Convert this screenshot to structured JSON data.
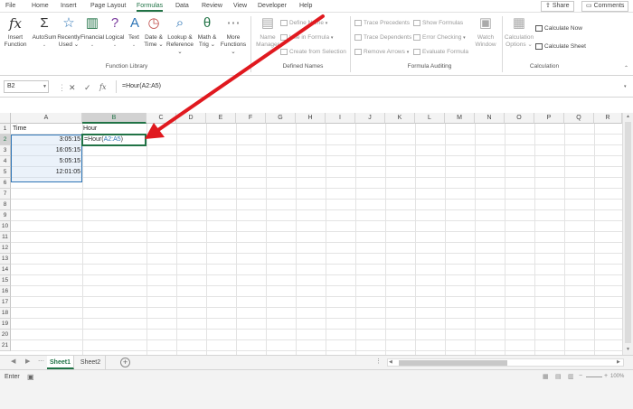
{
  "ribbon_tabs": [
    {
      "label": "File"
    },
    {
      "label": "Home"
    },
    {
      "label": "Insert"
    },
    {
      "label": "Page Layout"
    },
    {
      "label": "Formulas",
      "active": true
    },
    {
      "label": "Data"
    },
    {
      "label": "Review"
    },
    {
      "label": "View"
    },
    {
      "label": "Developer"
    },
    {
      "label": "Help"
    }
  ],
  "share_label": "Share",
  "comments_label": "Comments",
  "function_library": {
    "label": "Function Library",
    "insert_function": [
      "Insert",
      "Function"
    ],
    "autosum": [
      "AutoSum",
      "⌄"
    ],
    "recently_used": [
      "Recently",
      "Used ⌄"
    ],
    "financial": [
      "Financial",
      "⌄"
    ],
    "logical": [
      "Logical",
      "⌄"
    ],
    "text": [
      "Text",
      "⌄"
    ],
    "date_time": [
      "Date &",
      "Time ⌄"
    ],
    "lookup": [
      "Lookup &",
      "Reference ⌄"
    ],
    "math": [
      "Math &",
      "Trig ⌄"
    ],
    "more": [
      "More",
      "Functions ⌄"
    ]
  },
  "defined_names": {
    "label": "Defined Names",
    "name_manager": [
      "Name",
      "Manager"
    ],
    "define_name": "Define Name",
    "use_in_formula": "Use in Formula",
    "create_from_selection": "Create from Selection"
  },
  "formula_auditing": {
    "label": "Formula Auditing",
    "trace_precedents": "Trace Precedents",
    "trace_dependents": "Trace Dependents",
    "remove_arrows": "Remove Arrows",
    "show_formulas": "Show Formulas",
    "error_checking": "Error Checking",
    "evaluate_formula": "Evaluate Formula",
    "watch_window": [
      "Watch",
      "Window"
    ]
  },
  "calculation": {
    "label": "Calculation",
    "options": [
      "Calculation",
      "Options ⌄"
    ],
    "calculate_now": "Calculate Now",
    "calculate_sheet": "Calculate Sheet"
  },
  "name_box": "B2",
  "formula_bar": {
    "cancel": "✕",
    "enter": "✓",
    "fx": "fx",
    "formula": "=Hour(A2:A5)"
  },
  "columns": [
    "A",
    "B",
    "C",
    "D",
    "E",
    "F",
    "G",
    "H",
    "I",
    "J",
    "K",
    "L",
    "M",
    "N",
    "O",
    "P",
    "Q",
    "R"
  ],
  "rows": [
    "1",
    "2",
    "3",
    "4",
    "5",
    "6",
    "7",
    "8",
    "9",
    "10",
    "11",
    "12",
    "13",
    "14",
    "15",
    "16",
    "17",
    "18",
    "19",
    "20",
    "21"
  ],
  "cells": {
    "A1": "Time",
    "B1": "Hour",
    "A2": "3:05:15",
    "A3": "16:05:15",
    "A4": "5:05:15",
    "A5": "12:01:05",
    "B2_prefix": "=Hour(",
    "B2_ref": "A2:A5",
    "B2_suffix": ")"
  },
  "sheet_tabs": [
    {
      "label": "Sheet1",
      "active": true
    },
    {
      "label": "Sheet2"
    }
  ],
  "add_sheet": "+",
  "status_mode": "Enter",
  "zoom_label": "100%",
  "colors": {
    "accent": "#217346",
    "arrow": "#e0191f",
    "selection": "#2e75b6"
  }
}
